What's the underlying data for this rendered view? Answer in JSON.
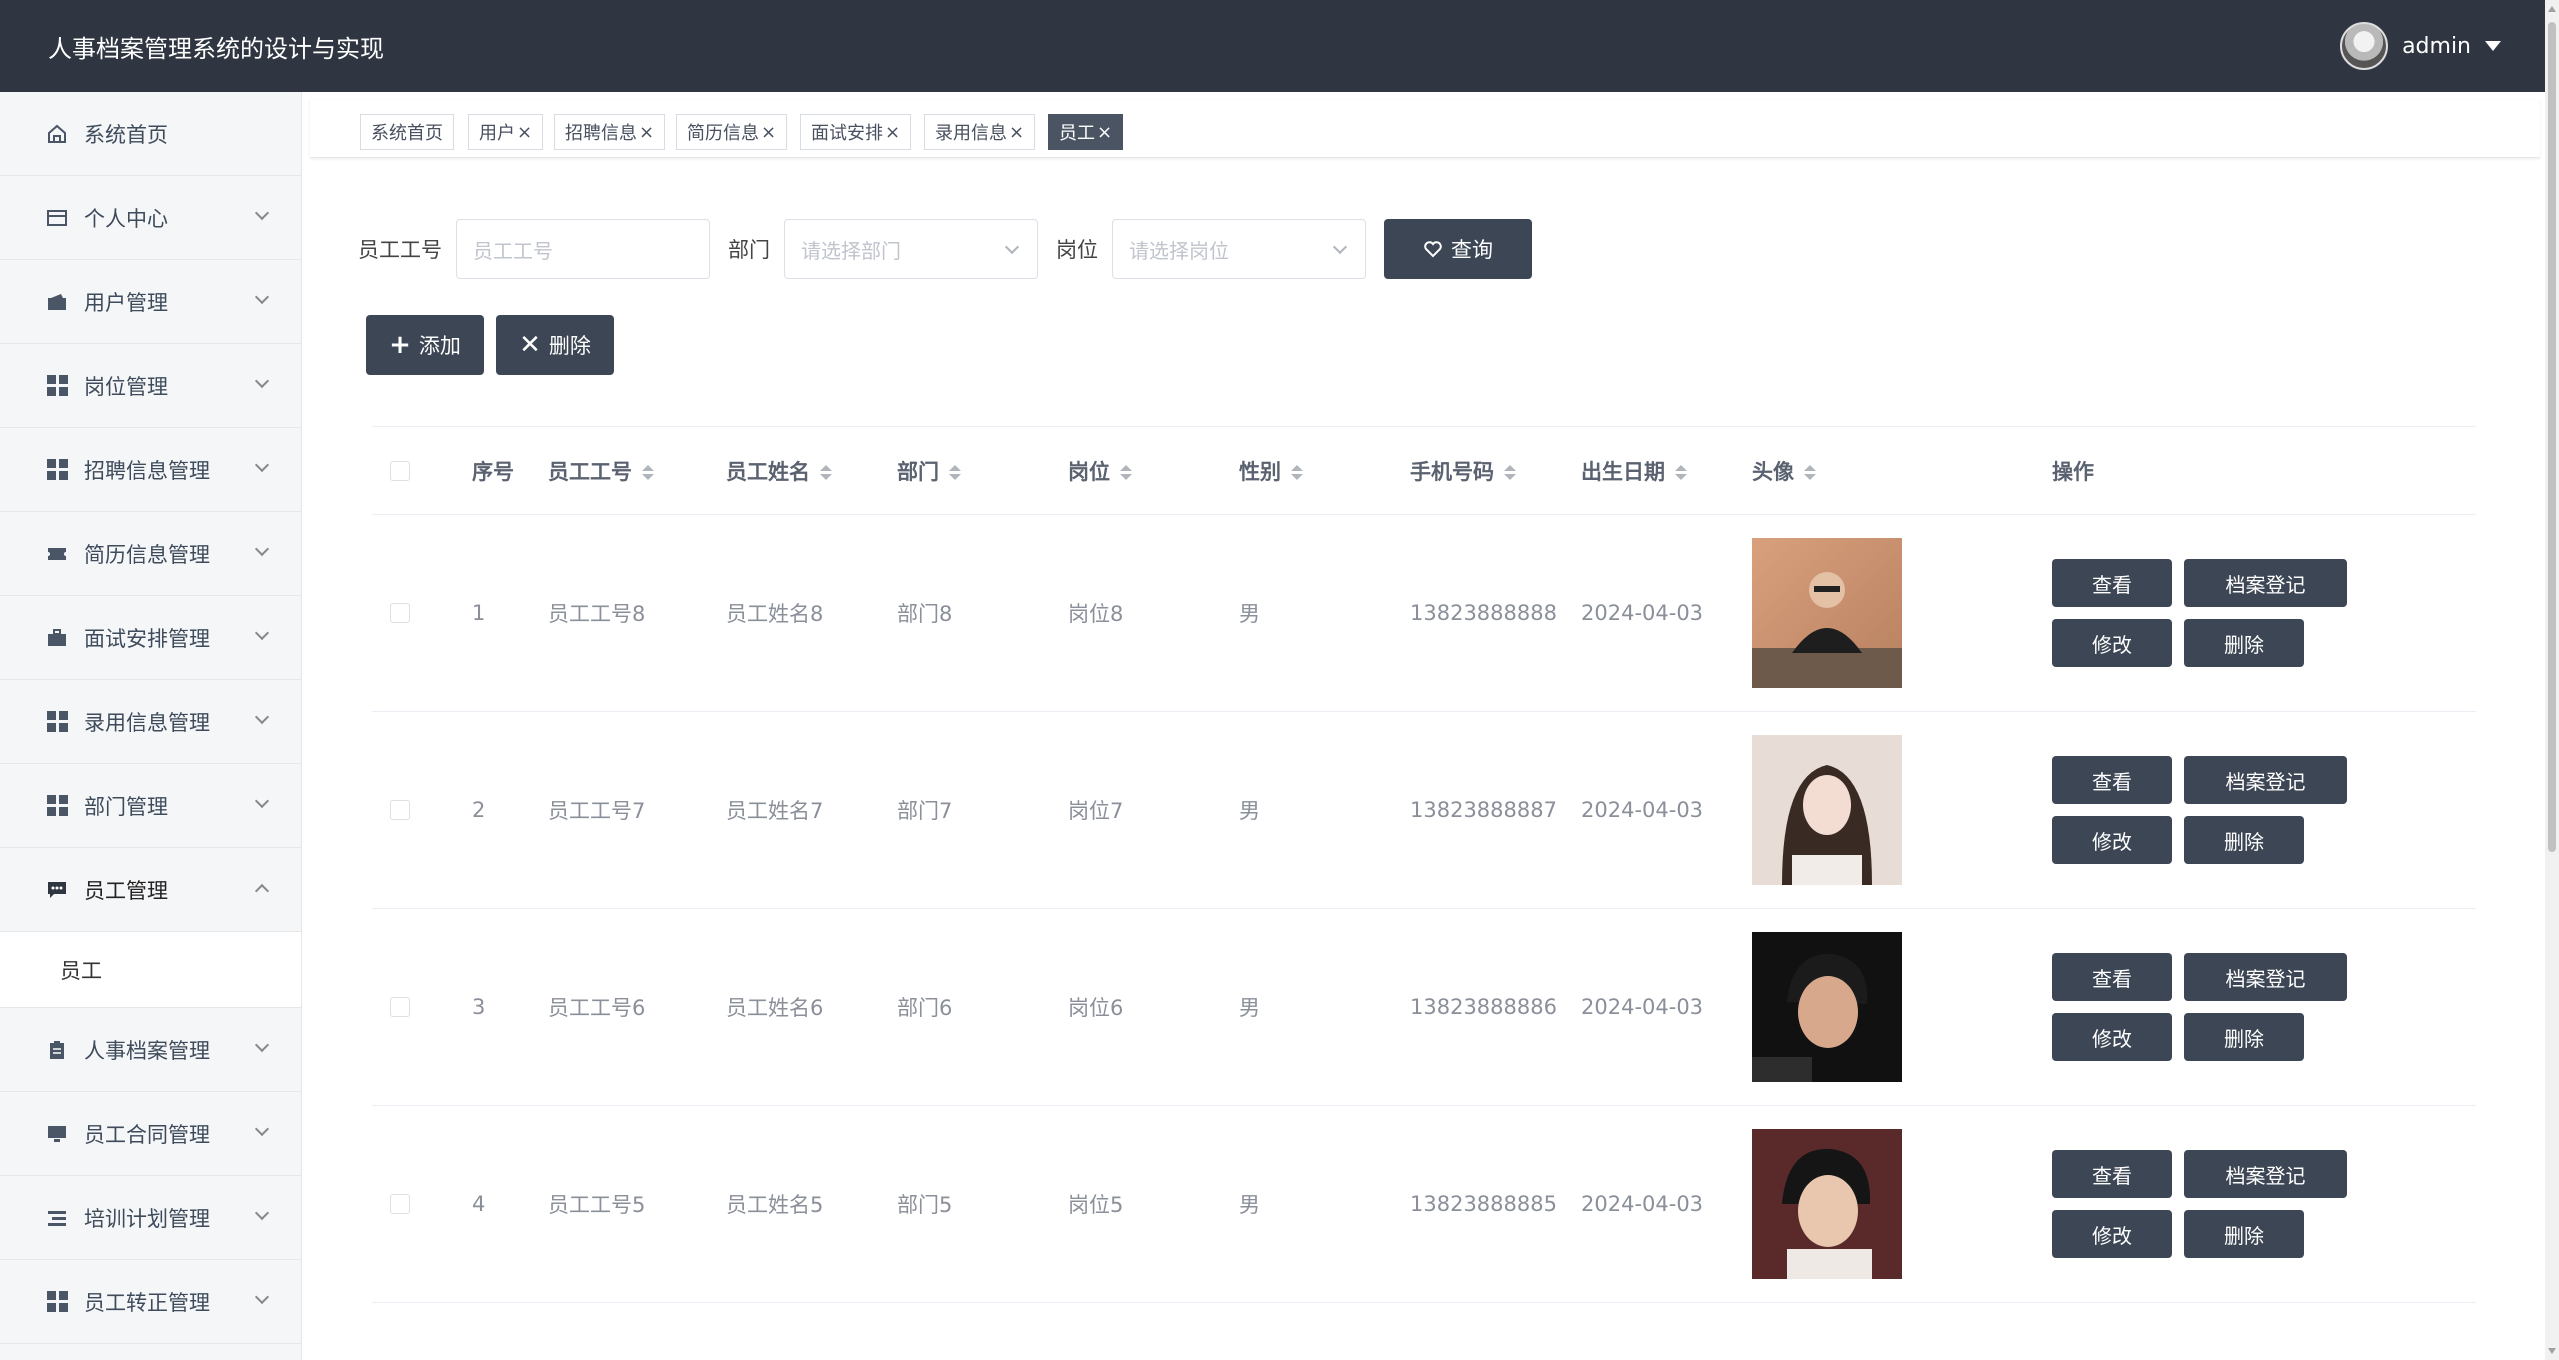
{
  "header": {
    "title": "人事档案管理系统的设计与实现",
    "username": "admin"
  },
  "sidebar": {
    "items": [
      {
        "label": "系统首页",
        "icon": "home-icon",
        "expandable": false
      },
      {
        "label": "个人中心",
        "icon": "card-icon",
        "expandable": true
      },
      {
        "label": "用户管理",
        "icon": "wallet-icon",
        "expandable": true
      },
      {
        "label": "岗位管理",
        "icon": "grid-icon",
        "expandable": true
      },
      {
        "label": "招聘信息管理",
        "icon": "grid-icon",
        "expandable": true
      },
      {
        "label": "简历信息管理",
        "icon": "ticket-icon",
        "expandable": true
      },
      {
        "label": "面试安排管理",
        "icon": "briefcase-icon",
        "expandable": true
      },
      {
        "label": "录用信息管理",
        "icon": "grid-icon",
        "expandable": true
      },
      {
        "label": "部门管理",
        "icon": "grid-icon",
        "expandable": true
      },
      {
        "label": "员工管理",
        "icon": "chat-icon",
        "expandable": true,
        "open": true
      }
    ],
    "submenu": {
      "label": "员工"
    },
    "items_after": [
      {
        "label": "人事档案管理",
        "icon": "clipboard-icon"
      },
      {
        "label": "员工合同管理",
        "icon": "monitor-icon"
      },
      {
        "label": "培训计划管理",
        "icon": "list-icon"
      },
      {
        "label": "员工转正管理",
        "icon": "grid-icon"
      }
    ]
  },
  "tabs": [
    {
      "label": "系统首页",
      "closable": false
    },
    {
      "label": "用户",
      "closable": true
    },
    {
      "label": "招聘信息",
      "closable": true
    },
    {
      "label": "简历信息",
      "closable": true
    },
    {
      "label": "面试安排",
      "closable": true
    },
    {
      "label": "录用信息",
      "closable": true
    },
    {
      "label": "员工",
      "closable": true,
      "active": true
    }
  ],
  "search": {
    "employee_no_label": "员工工号",
    "employee_no_placeholder": "员工工号",
    "dept_label": "部门",
    "dept_placeholder": "请选择部门",
    "post_label": "岗位",
    "post_placeholder": "请选择岗位",
    "query_label": "查询"
  },
  "actions": {
    "add_label": "添加",
    "delete_label": "删除"
  },
  "table": {
    "headers": {
      "idx": "序号",
      "no": "员工工号",
      "name": "员工姓名",
      "dept": "部门",
      "post": "岗位",
      "sex": "性别",
      "phone": "手机号码",
      "birth": "出生日期",
      "img": "头像",
      "ops": "操作"
    },
    "op_labels": {
      "view": "查看",
      "archive": "档案登记",
      "edit": "修改",
      "delete": "删除"
    },
    "rows": [
      {
        "idx": "1",
        "no": "员工工号8",
        "name": "员工姓名8",
        "dept": "部门8",
        "post": "岗位8",
        "sex": "男",
        "phone": "13823888888",
        "birth": "2024-04-03"
      },
      {
        "idx": "2",
        "no": "员工工号7",
        "name": "员工姓名7",
        "dept": "部门7",
        "post": "岗位7",
        "sex": "男",
        "phone": "13823888887",
        "birth": "2024-04-03"
      },
      {
        "idx": "3",
        "no": "员工工号6",
        "name": "员工姓名6",
        "dept": "部门6",
        "post": "岗位6",
        "sex": "男",
        "phone": "13823888886",
        "birth": "2024-04-03"
      },
      {
        "idx": "4",
        "no": "员工工号5",
        "name": "员工姓名5",
        "dept": "部门5",
        "post": "岗位5",
        "sex": "男",
        "phone": "13823888885",
        "birth": "2024-04-03"
      }
    ]
  }
}
